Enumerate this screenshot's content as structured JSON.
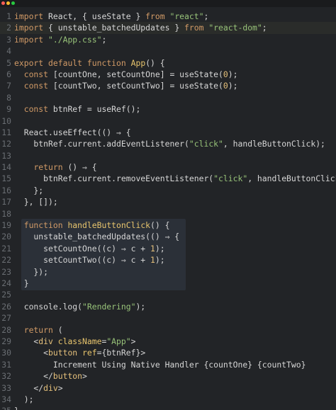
{
  "window": {
    "traffic_lights": [
      {
        "name": "close",
        "color": "#ff5f57"
      },
      {
        "name": "minimize",
        "color": "#febc2e"
      },
      {
        "name": "zoom",
        "color": "#28c840"
      }
    ]
  },
  "theme": {
    "background": "#222427",
    "line_number": "#6a6e73",
    "keyword": "#d19a66",
    "string": "#98c379",
    "number": "#e5c07b",
    "function": "#e8c56d",
    "tag": "#e5c07b",
    "punct": "#c8c8c8",
    "plain": "#d6d6d6",
    "selection_block": "#2b3038"
  },
  "editor": {
    "highlighted_line": 2,
    "selected_range": [
      19,
      24
    ],
    "lines": [
      {
        "n": "1",
        "tokens": [
          [
            "kw",
            "import"
          ],
          [
            "p",
            " React, { useState } "
          ],
          [
            "kw",
            "from"
          ],
          [
            "p",
            " "
          ],
          [
            "str",
            "\"react\""
          ],
          [
            "p",
            ";"
          ]
        ]
      },
      {
        "n": "2",
        "tokens": [
          [
            "kw",
            "import"
          ],
          [
            "p",
            " { unstable_batchedUpdates } "
          ],
          [
            "kw",
            "from"
          ],
          [
            "p",
            " "
          ],
          [
            "str",
            "\"react-dom\""
          ],
          [
            "p",
            ";"
          ]
        ]
      },
      {
        "n": "3",
        "tokens": [
          [
            "kw",
            "import"
          ],
          [
            "p",
            " "
          ],
          [
            "str",
            "\"./App.css\""
          ],
          [
            "p",
            ";"
          ]
        ]
      },
      {
        "n": "4",
        "tokens": []
      },
      {
        "n": "5",
        "tokens": [
          [
            "kw",
            "export"
          ],
          [
            "p",
            " "
          ],
          [
            "kw",
            "default"
          ],
          [
            "p",
            " "
          ],
          [
            "kw",
            "function"
          ],
          [
            "p",
            " "
          ],
          [
            "fn",
            "App"
          ],
          [
            "p",
            "() {"
          ]
        ]
      },
      {
        "n": "6",
        "tokens": [
          [
            "p",
            "  "
          ],
          [
            "kw",
            "const"
          ],
          [
            "p",
            " [countOne, setCountOne] = useState("
          ],
          [
            "num",
            "0"
          ],
          [
            "p",
            ");"
          ]
        ]
      },
      {
        "n": "7",
        "tokens": [
          [
            "p",
            "  "
          ],
          [
            "kw",
            "const"
          ],
          [
            "p",
            " [countTwo, setCountTwo] = useState("
          ],
          [
            "num",
            "0"
          ],
          [
            "p",
            ");"
          ]
        ]
      },
      {
        "n": "8",
        "tokens": []
      },
      {
        "n": "9",
        "tokens": [
          [
            "p",
            "  "
          ],
          [
            "kw",
            "const"
          ],
          [
            "p",
            " btnRef = useRef();"
          ]
        ]
      },
      {
        "n": "10",
        "tokens": []
      },
      {
        "n": "11",
        "tokens": [
          [
            "p",
            "  React.useEffect(() ⇒ {"
          ]
        ]
      },
      {
        "n": "12",
        "tokens": [
          [
            "p",
            "    btnRef.current.addEventListener("
          ],
          [
            "str",
            "\"click\""
          ],
          [
            "p",
            ", handleButtonClick);"
          ]
        ]
      },
      {
        "n": "13",
        "tokens": []
      },
      {
        "n": "14",
        "tokens": [
          [
            "p",
            "    "
          ],
          [
            "kw",
            "return"
          ],
          [
            "p",
            " () ⇒ {"
          ]
        ]
      },
      {
        "n": "15",
        "tokens": [
          [
            "p",
            "      btnRef.current.removeEventListener("
          ],
          [
            "str",
            "\"click\""
          ],
          [
            "p",
            ", handleButtonClick);"
          ]
        ]
      },
      {
        "n": "16",
        "tokens": [
          [
            "p",
            "    };"
          ]
        ]
      },
      {
        "n": "17",
        "tokens": [
          [
            "p",
            "  }, []);"
          ]
        ]
      },
      {
        "n": "18",
        "tokens": []
      },
      {
        "n": "19",
        "tokens": [
          [
            "p",
            "  "
          ],
          [
            "kw",
            "function"
          ],
          [
            "p",
            " "
          ],
          [
            "fn",
            "handleButtonClick"
          ],
          [
            "p",
            "() {"
          ]
        ]
      },
      {
        "n": "20",
        "tokens": [
          [
            "p",
            "    unstable_batchedUpdates(() ⇒ {"
          ]
        ]
      },
      {
        "n": "21",
        "tokens": [
          [
            "p",
            "      setCountOne((c) ⇒ c + "
          ],
          [
            "num",
            "1"
          ],
          [
            "p",
            ");"
          ]
        ]
      },
      {
        "n": "22",
        "tokens": [
          [
            "p",
            "      setCountTwo((c) ⇒ c + "
          ],
          [
            "num",
            "1"
          ],
          [
            "p",
            ");"
          ]
        ]
      },
      {
        "n": "23",
        "tokens": [
          [
            "p",
            "    });"
          ]
        ]
      },
      {
        "n": "24",
        "tokens": [
          [
            "p",
            "  }"
          ]
        ]
      },
      {
        "n": "25",
        "tokens": []
      },
      {
        "n": "26",
        "tokens": [
          [
            "p",
            "  console.log("
          ],
          [
            "str",
            "\"Rendering\""
          ],
          [
            "p",
            ");"
          ]
        ]
      },
      {
        "n": "27",
        "tokens": []
      },
      {
        "n": "28",
        "tokens": [
          [
            "p",
            "  "
          ],
          [
            "kw",
            "return"
          ],
          [
            "p",
            " ("
          ]
        ]
      },
      {
        "n": "29",
        "tokens": [
          [
            "p",
            "    <"
          ],
          [
            "tag",
            "div"
          ],
          [
            "p",
            " "
          ],
          [
            "attr",
            "className"
          ],
          [
            "p",
            "="
          ],
          [
            "str",
            "\"App\""
          ],
          [
            "p",
            ">"
          ]
        ]
      },
      {
        "n": "30",
        "tokens": [
          [
            "p",
            "      <"
          ],
          [
            "tag",
            "button"
          ],
          [
            "p",
            " "
          ],
          [
            "attr",
            "ref"
          ],
          [
            "p",
            "={btnRef}>"
          ]
        ]
      },
      {
        "n": "31",
        "tokens": [
          [
            "p",
            "        Increment Using Native Handler {countOne} {countTwo}"
          ]
        ]
      },
      {
        "n": "32",
        "tokens": [
          [
            "p",
            "      </"
          ],
          [
            "tag",
            "button"
          ],
          [
            "p",
            ">"
          ]
        ]
      },
      {
        "n": "33",
        "tokens": [
          [
            "p",
            "    </"
          ],
          [
            "tag",
            "div"
          ],
          [
            "p",
            ">"
          ]
        ]
      },
      {
        "n": "34",
        "tokens": [
          [
            "p",
            "  );"
          ]
        ]
      },
      {
        "n": "35",
        "tokens": [
          [
            "p",
            "}"
          ]
        ]
      }
    ]
  }
}
